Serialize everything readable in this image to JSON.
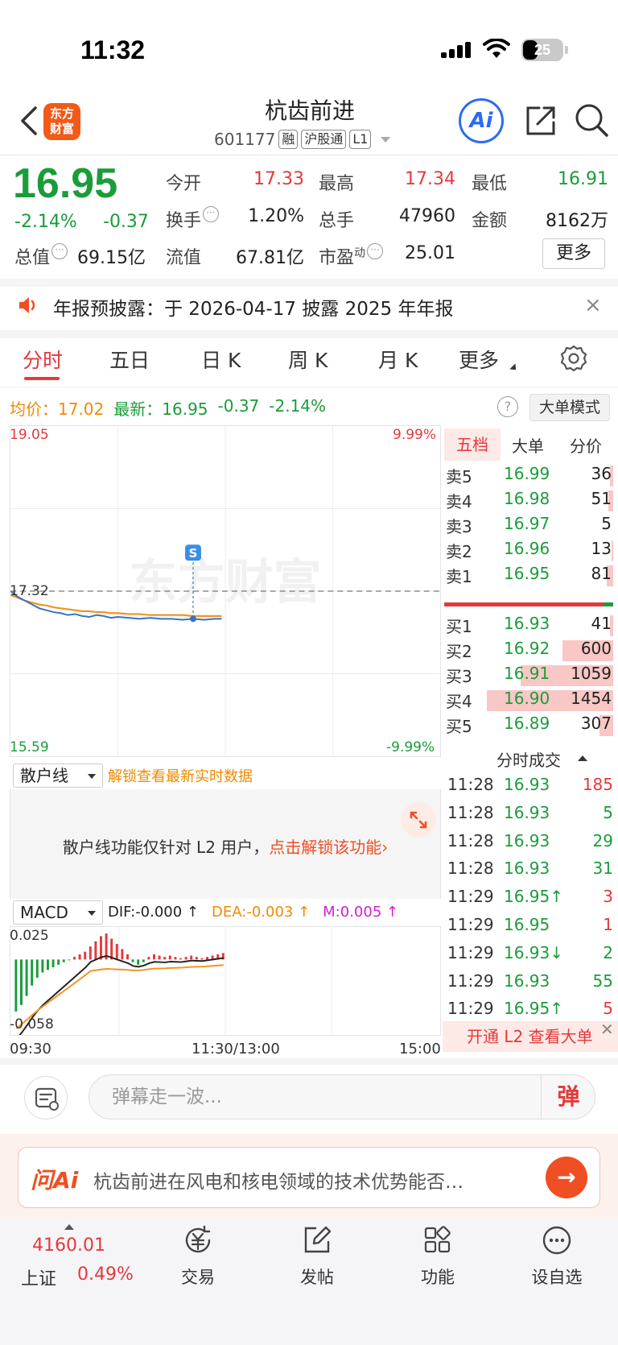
{
  "status_bar": {
    "time": "11:32",
    "battery": "25"
  },
  "header": {
    "logo_text": "东方\n财富",
    "stock_name": "杭齿前进",
    "stock_code": "601177",
    "tags": [
      "融",
      "沪股通",
      "L1"
    ],
    "ai_label": "Ai"
  },
  "quote": {
    "price": "16.95",
    "change_pct": "-2.14%",
    "change_val": "-0.37",
    "open_label": "今开",
    "open": "17.33",
    "high_label": "最高",
    "high": "17.34",
    "low_label": "最低",
    "low": "16.91",
    "turnover_label": "换手",
    "turnover": "1.20%",
    "volume_label": "总手",
    "volume": "47960",
    "amount_label": "金额",
    "amount": "8162万",
    "mktcap_label": "总值",
    "mktcap": "69.15亿",
    "float_label": "流值",
    "float": "67.81亿",
    "pe_label": "市盈",
    "pe_sup": "动",
    "pe": "25.01",
    "more_label": "更多"
  },
  "notice": {
    "text": "年报预披露：于 2026-04-17 披露 2025 年年报",
    "close": "×"
  },
  "tabs": [
    "分时",
    "五日",
    "日 K",
    "周 K",
    "月 K",
    "更多"
  ],
  "chart_header": {
    "avg_label": "均价：",
    "avg": "17.02",
    "latest_label": "最新：",
    "latest": "16.95",
    "latest_change": "-0.37",
    "latest_pct": "-2.14%",
    "help": "?",
    "big_order_mode": "大单模式"
  },
  "main_chart_labels": {
    "y_top": "19.05",
    "y_mid": "17.32",
    "y_bottom": "15.59",
    "pct_top": "9.99%",
    "pct_bottom": "-9.99%",
    "marker": "S",
    "watermark": "东方财富"
  },
  "chart_data": [
    {
      "type": "line",
      "ylim": [
        15.59,
        19.05
      ],
      "reference": 17.32,
      "xlim": [
        0,
        240
      ],
      "series": [
        {
          "color": "#3a72c8",
          "x": [
            0,
            4,
            8,
            12,
            16,
            20,
            24,
            28,
            32,
            36,
            40,
            44,
            48,
            52,
            56,
            60,
            66,
            72,
            78,
            84,
            90,
            96,
            102,
            108,
            114,
            118
          ],
          "values": [
            17.32,
            17.26,
            17.22,
            17.18,
            17.14,
            17.12,
            17.1,
            17.09,
            17.07,
            17.08,
            17.06,
            17.05,
            17.07,
            17.06,
            17.04,
            17.05,
            17.04,
            17.03,
            17.04,
            17.03,
            17.03,
            17.02,
            17.03,
            17.02,
            17.03,
            17.03
          ]
        },
        {
          "color": "#f0961e",
          "x": [
            0,
            4,
            8,
            12,
            16,
            20,
            24,
            28,
            32,
            36,
            40,
            44,
            48,
            52,
            56,
            60,
            66,
            72,
            78,
            84,
            90,
            96,
            102,
            108,
            114,
            118
          ],
          "values": [
            17.28,
            17.25,
            17.22,
            17.2,
            17.18,
            17.17,
            17.15,
            17.14,
            17.13,
            17.12,
            17.11,
            17.11,
            17.1,
            17.1,
            17.09,
            17.09,
            17.08,
            17.08,
            17.07,
            17.07,
            17.07,
            17.07,
            17.06,
            17.06,
            17.06,
            17.06
          ]
        }
      ]
    },
    {
      "type": "bar",
      "ylim": [
        -0.058,
        0.025
      ],
      "xlim": [
        0,
        240
      ],
      "x": [
        2,
        5,
        8,
        11,
        14,
        17,
        20,
        23,
        26,
        29,
        32,
        35,
        38,
        41,
        44,
        47,
        50,
        53,
        56,
        59,
        62,
        65,
        68,
        71,
        74,
        77,
        80,
        83,
        86,
        89,
        92,
        95,
        98,
        101,
        104,
        107,
        110,
        113,
        116,
        119
      ],
      "values": [
        -0.04,
        -0.035,
        -0.028,
        -0.02,
        -0.014,
        -0.01,
        -0.008,
        -0.006,
        -0.004,
        -0.002,
        0.0,
        0.002,
        0.004,
        0.006,
        0.01,
        0.014,
        0.018,
        0.02,
        0.016,
        0.012,
        0.008,
        0.004,
        -0.002,
        -0.004,
        -0.002,
        0.002,
        0.004,
        0.003,
        0.002,
        0.003,
        0.002,
        0.001,
        0.002,
        0.003,
        0.002,
        0.001,
        0.002,
        0.003,
        0.004,
        0.005
      ]
    }
  ],
  "orderbook": {
    "tabs": [
      "五档",
      "大单",
      "分价"
    ],
    "asks": [
      {
        "label": "卖5",
        "price": "16.99",
        "vol": "36",
        "share": 0.02
      },
      {
        "label": "卖4",
        "price": "16.98",
        "vol": "51",
        "share": 0.03
      },
      {
        "label": "卖3",
        "price": "16.97",
        "vol": "5",
        "share": 0.0
      },
      {
        "label": "卖2",
        "price": "16.96",
        "vol": "13",
        "share": 0.01
      },
      {
        "label": "卖1",
        "price": "16.95",
        "vol": "81",
        "share": 0.04
      }
    ],
    "bids": [
      {
        "label": "买1",
        "price": "16.93",
        "vol": "41",
        "share": 0.02
      },
      {
        "label": "买2",
        "price": "16.92",
        "vol": "600",
        "share": 0.3
      },
      {
        "label": "买3",
        "price": "16.91",
        "vol": "1059",
        "share": 0.55
      },
      {
        "label": "买4",
        "price": "16.90",
        "vol": "1454",
        "share": 0.75
      },
      {
        "label": "买5",
        "price": "16.89",
        "vol": "307",
        "share": 0.08
      }
    ]
  },
  "ticks": {
    "title": "分时成交",
    "rows": [
      {
        "time": "11:28",
        "price": "16.93",
        "vol": "185",
        "color": "#e4393c"
      },
      {
        "time": "11:28",
        "price": "16.93",
        "vol": "5",
        "color": "#1a9c3a"
      },
      {
        "time": "11:28",
        "price": "16.93",
        "vol": "29",
        "color": "#1a9c3a"
      },
      {
        "time": "11:28",
        "price": "16.93",
        "vol": "31",
        "color": "#1a9c3a"
      },
      {
        "time": "11:29",
        "price": "16.95↑",
        "vol": "3",
        "color": "#e4393c"
      },
      {
        "time": "11:29",
        "price": "16.95",
        "vol": "1",
        "color": "#e4393c"
      },
      {
        "time": "11:29",
        "price": "16.93↓",
        "vol": "2",
        "color": "#1a9c3a"
      },
      {
        "time": "11:29",
        "price": "16.93",
        "vol": "55",
        "color": "#1a9c3a"
      },
      {
        "time": "11:29",
        "price": "16.95↑",
        "vol": "5",
        "color": "#e4393c"
      }
    ],
    "l2_banner": "开通 L2 查看大单",
    "l2_close": "✕"
  },
  "retail": {
    "select": "散户线",
    "unlock": "解锁查看最新实时数据",
    "msg_prefix": "散户线功能仅针对 L2 用户，",
    "msg_link": "点击解锁该功能›"
  },
  "macd": {
    "select": "MACD",
    "dif": "DIF:-0.000 ↑",
    "dea": "DEA:-0.003 ↑",
    "m": "M:0.005 ↑",
    "y_top": "0.025",
    "y_bottom": "-0.058"
  },
  "time_axis": {
    "start": "09:30",
    "mid": "11:30/13:00",
    "end": "15:00"
  },
  "danmaku": {
    "placeholder": "弹幕走一波...",
    "send": "弹"
  },
  "ai_ask": {
    "logo": "问Ai",
    "text": "杭齿前进在风电和核电领域的技术优势能否…",
    "go": "→"
  },
  "bottom_nav": {
    "index_value": "4160.01",
    "index_name": "上证",
    "index_pct": "0.49%",
    "items": [
      "交易",
      "发帖",
      "功能",
      "设自选"
    ]
  },
  "colors": {
    "up": "#e4393c",
    "down": "#1a9c3a",
    "avg": "#f0961e",
    "price_line": "#3a72c8",
    "accent": "#f04e23"
  }
}
